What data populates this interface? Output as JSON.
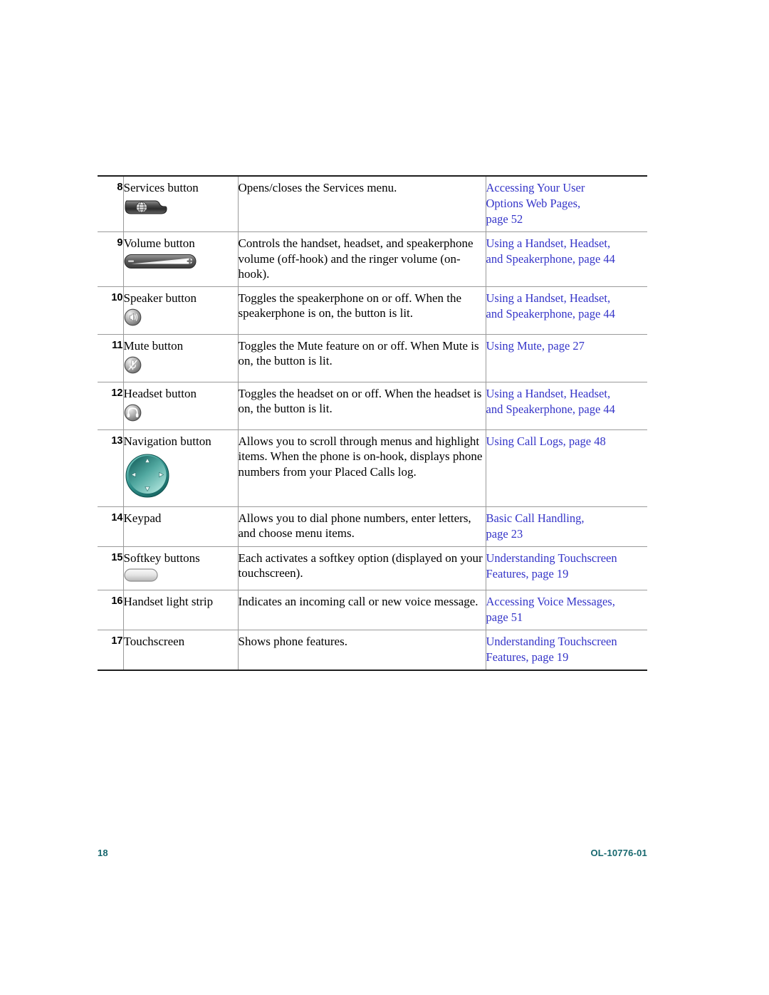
{
  "document": {
    "footer": {
      "page_number": "18",
      "doc_id": "OL-10776-01",
      "color": "#16676e"
    },
    "link_color": "#3434c8"
  },
  "table": {
    "rows": [
      {
        "num": "8",
        "feature": "Services button",
        "icon": "services-button-icon",
        "description": "Opens/closes the Services menu.",
        "xref": [
          "Accessing Your User",
          "Options Web Pages,",
          "page 52"
        ]
      },
      {
        "num": "9",
        "feature": "Volume button",
        "icon": "volume-rocker-icon",
        "description": "Controls the handset, headset, and speakerphone volume (off-hook) and the ringer volume (on-hook).",
        "xref": [
          "Using a Handset, Headset,",
          "and Speakerphone, page 44"
        ]
      },
      {
        "num": "10",
        "feature": "Speaker button",
        "icon": "speaker-button-icon",
        "description": "Toggles the speakerphone on or off. When the speakerphone is on, the button is lit.",
        "xref": [
          "Using a Handset, Headset,",
          "and Speakerphone, page 44"
        ]
      },
      {
        "num": "11",
        "feature": "Mute button",
        "icon": "mute-button-icon",
        "description": "Toggles the Mute feature on or off. When Mute is on, the button is lit.",
        "xref": [
          "Using Mute, page 27"
        ]
      },
      {
        "num": "12",
        "feature": "Headset button",
        "icon": "headset-button-icon",
        "description": "Toggles the headset on or off. When the headset is on, the button is lit.",
        "xref": [
          "Using a Handset, Headset,",
          "and Speakerphone, page 44"
        ]
      },
      {
        "num": "13",
        "feature": "Navigation button",
        "icon": "navigation-button-icon",
        "description": "Allows you to scroll through menus and highlight items. When the phone is on-hook, displays phone numbers from your Placed Calls log.",
        "xref": [
          "Using Call Logs, page 48"
        ]
      },
      {
        "num": "14",
        "feature": "Keypad",
        "icon": null,
        "description": "Allows you to dial phone numbers, enter letters, and choose menu items.",
        "xref": [
          "Basic Call Handling,",
          "page 23"
        ]
      },
      {
        "num": "15",
        "feature": "Softkey buttons",
        "icon": "softkey-button-icon",
        "description": "Each activates a softkey option (displayed on your touchscreen).",
        "xref": [
          "Understanding Touchscreen",
          "Features, page 19"
        ]
      },
      {
        "num": "16",
        "feature": "Handset light strip",
        "icon": null,
        "description": "Indicates an incoming call or new voice message.",
        "xref": [
          "Accessing Voice Messages,",
          "page 51"
        ]
      },
      {
        "num": "17",
        "feature": "Touchscreen",
        "icon": null,
        "description": "Shows phone features.",
        "xref": [
          "Understanding Touchscreen",
          "Features, page 19"
        ]
      }
    ]
  }
}
